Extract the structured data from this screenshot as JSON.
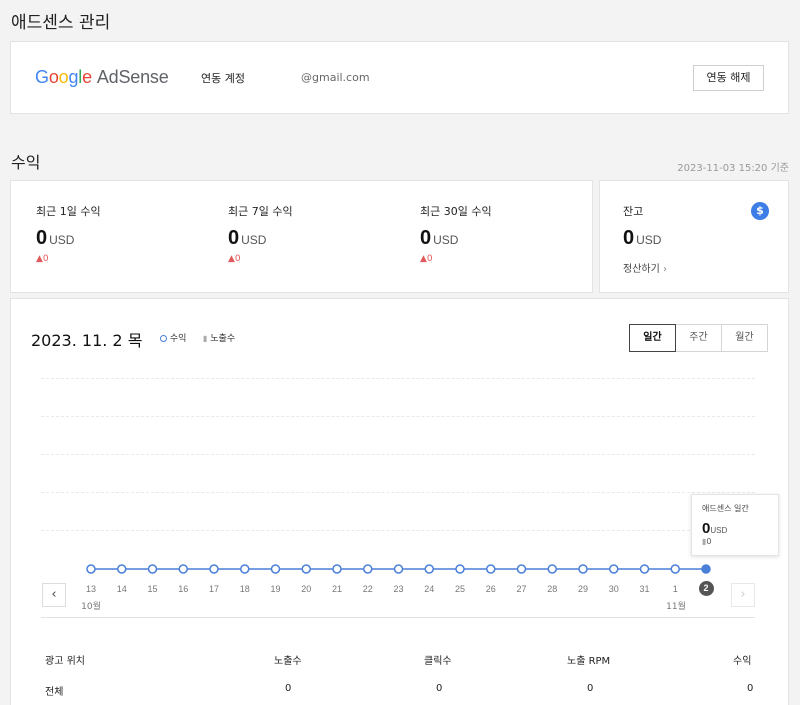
{
  "page": {
    "title": "애드센스 관리"
  },
  "account": {
    "logo_google": [
      "G",
      "o",
      "o",
      "g",
      "l",
      "e"
    ],
    "logo_product": "AdSense",
    "linked_label": "연동 계정",
    "email": "@gmail.com",
    "unlink_button": "연동 해제"
  },
  "revenue": {
    "title": "수익",
    "as_of": "2023-11-03 15:20 기준",
    "stats": [
      {
        "label": "최근 1일 수익",
        "value": "0",
        "unit": "USD",
        "change": "0"
      },
      {
        "label": "최근 7일 수익",
        "value": "0",
        "unit": "USD",
        "change": "0"
      },
      {
        "label": "최근 30일 수익",
        "value": "0",
        "unit": "USD",
        "change": "0"
      }
    ],
    "balance": {
      "label": "잔고",
      "value": "0",
      "unit": "USD",
      "settle_link": "정산하기",
      "icon": "dollar-icon",
      "icon_glyph": "$"
    }
  },
  "chart": {
    "date_title": "2023. 11. 2 목",
    "legend_revenue": "수익",
    "legend_impressions": "노출수",
    "period_tabs": [
      {
        "label": "일간",
        "active": true
      },
      {
        "label": "주간",
        "active": false
      },
      {
        "label": "월간",
        "active": false
      }
    ],
    "tooltip": {
      "title": "애드센스 일간",
      "value": "0",
      "unit": "USD",
      "impressions": "0"
    },
    "month_labels": {
      "oct": "10월",
      "nov": "11월"
    },
    "line_color": "#4a7fd9"
  },
  "chart_data": {
    "type": "line",
    "x": [
      "13",
      "14",
      "15",
      "16",
      "17",
      "18",
      "19",
      "20",
      "21",
      "22",
      "23",
      "24",
      "25",
      "26",
      "27",
      "28",
      "29",
      "30",
      "31",
      "1",
      "2"
    ],
    "series": [
      {
        "name": "수익",
        "values": [
          0,
          0,
          0,
          0,
          0,
          0,
          0,
          0,
          0,
          0,
          0,
          0,
          0,
          0,
          0,
          0,
          0,
          0,
          0,
          0,
          0
        ]
      }
    ],
    "selected_index": 20
  },
  "table": {
    "headers": [
      "광고 위치",
      "노출수",
      "클릭수",
      "노출 RPM",
      "수익"
    ],
    "rows": [
      [
        "전체",
        "0",
        "0",
        "0",
        "0"
      ]
    ]
  }
}
